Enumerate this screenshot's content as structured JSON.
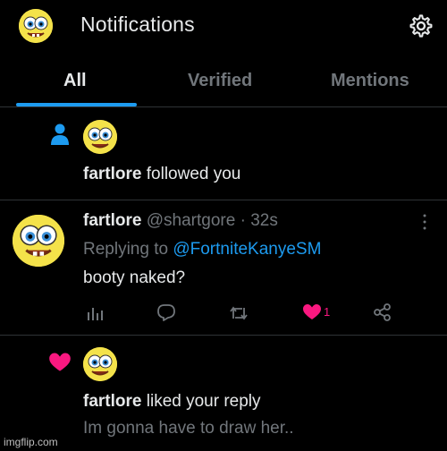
{
  "header": {
    "title": "Notifications",
    "profile_icon": "spongebob-avatar-icon",
    "settings_icon": "gear-icon"
  },
  "tabs": [
    {
      "label": "All",
      "active": true
    },
    {
      "label": "Verified",
      "active": false
    },
    {
      "label": "Mentions",
      "active": false
    }
  ],
  "notifications": {
    "follow": {
      "icon": "person-icon",
      "user": "fartlore",
      "action": "followed you"
    },
    "reply": {
      "name": "fartlore",
      "handle": "@shartgore",
      "separator": "·",
      "time": "32s",
      "replying_prefix": "Replying to",
      "replying_to": "@FortniteKanyeSM",
      "body": "booty naked?",
      "actions": {
        "analytics_icon": "analytics-icon",
        "reply_icon": "reply-icon",
        "retweet_icon": "retweet-icon",
        "like_icon": "heart-icon",
        "like_count": "1",
        "share_icon": "share-icon"
      },
      "more_icon": "more-vertical-icon"
    },
    "like": {
      "icon": "heart-icon",
      "user": "fartlore",
      "action": "liked your reply",
      "quote": "Im gonna have to draw her.."
    }
  },
  "watermark": "imgflip.com",
  "colors": {
    "accent": "#1d9bf0",
    "like": "#f91880",
    "muted": "#71767b",
    "avatar": "#f4e24a"
  }
}
